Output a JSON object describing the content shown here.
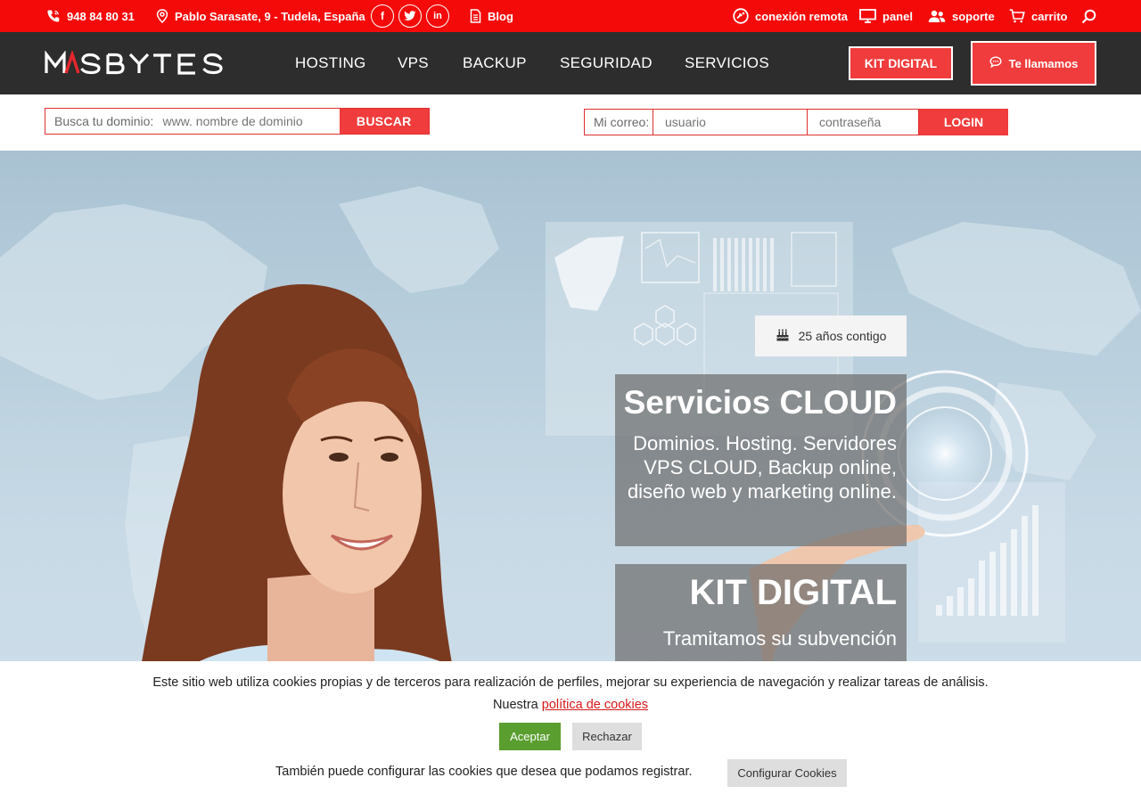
{
  "topbar": {
    "phone": "948 84 80 31",
    "address": "Pablo Sarasate, 9 - Tudela, España",
    "social": [
      "facebook",
      "twitter",
      "linkedin"
    ],
    "blog": "Blog",
    "remote": "conexión remota",
    "panel": "panel",
    "support": "soporte",
    "cart": "carrito",
    "icons": [
      "phone-icon",
      "location-pin-icon",
      "document-icon",
      "remote-connection-icon",
      "monitor-icon",
      "users-icon",
      "cart-icon",
      "search-icon"
    ]
  },
  "nav": {
    "logo": "MASBYTES",
    "links": [
      "HOSTING",
      "VPS",
      "BACKUP",
      "SEGURIDAD",
      "SERVICIOS"
    ],
    "kit_digital": "KIT DIGITAL",
    "call_us": "Te llamamos"
  },
  "domain_search": {
    "label": "Busca tu dominio:",
    "placeholder": "www. nombre de dominio",
    "button": "BUSCAR"
  },
  "login": {
    "label": "Mi correo:",
    "user_placeholder": "usuario",
    "password_placeholder": "contraseña",
    "button": "LOGIN"
  },
  "hero": {
    "badge": "25 años contigo",
    "box1_title": "Servicios CLOUD",
    "box1_text": "Dominios. Hosting. Servidores VPS CLOUD, Backup online, diseño web y marketing online.",
    "box2_title": "KIT DIGITAL",
    "box2_text": "Tramitamos su subvención"
  },
  "cookie": {
    "line1": "Este sitio web utiliza cookies propias y de terceros para realización de perfiles, mejorar su experiencia de navegación y realizar tareas de análisis.",
    "line2_prefix": "Nuestra",
    "policy_link": "política de cookies",
    "accept": "Aceptar",
    "reject": "Rechazar",
    "line3": "También puede configurar las cookies que desea que podamos registrar.",
    "configure": "Configurar Cookies"
  },
  "colors": {
    "topbar": "#f50a0a",
    "nav": "#2d2d2d",
    "accent": "#f03c3c",
    "accept": "#5a9e2f"
  }
}
